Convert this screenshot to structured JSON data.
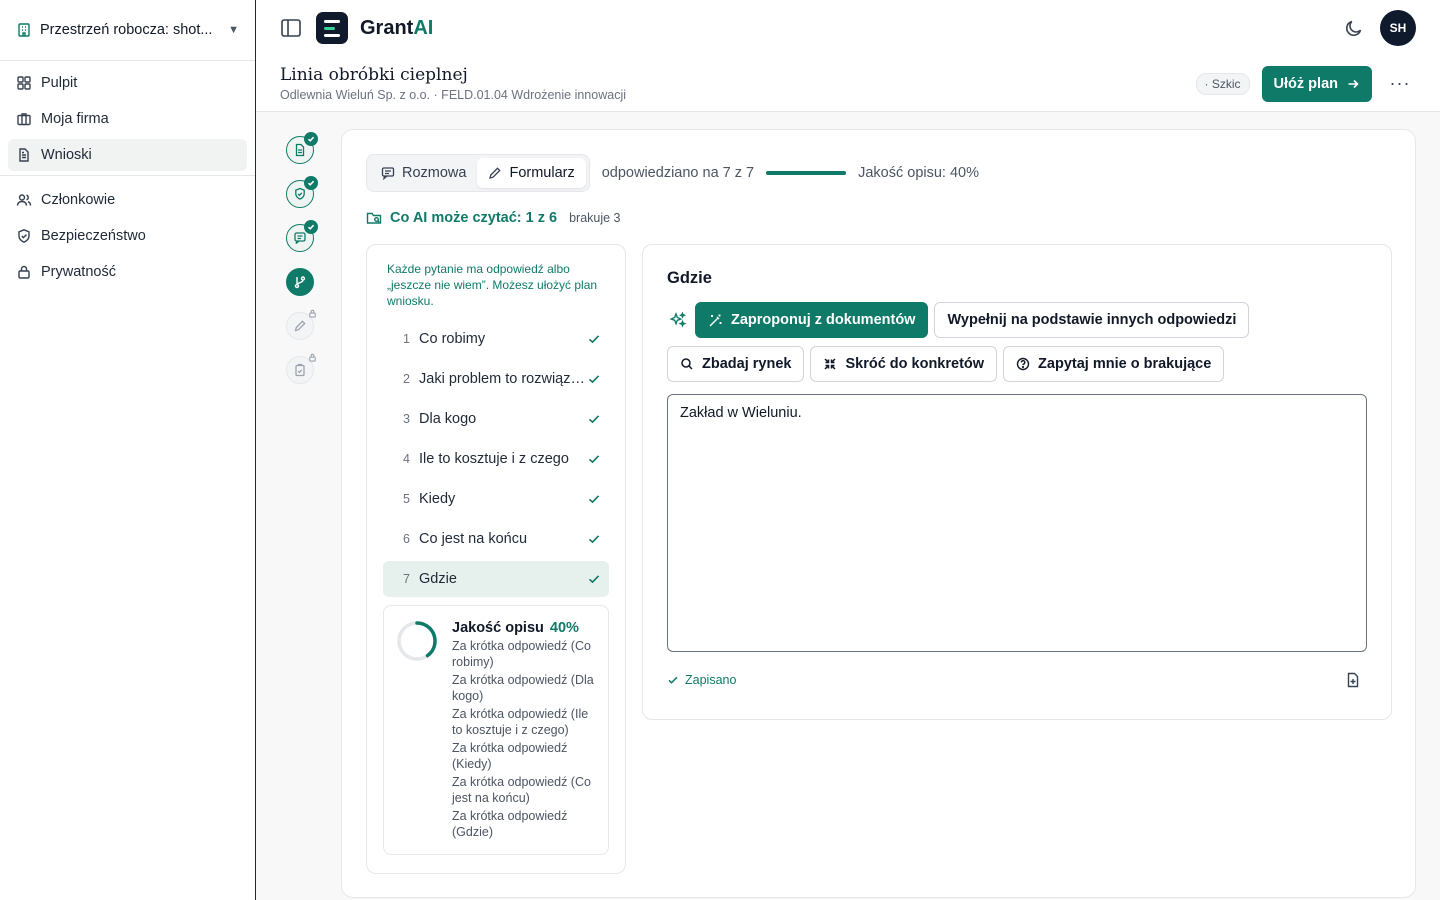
{
  "colors": {
    "brand": "#0f7a68",
    "navy": "#0f1b2d"
  },
  "sidebar": {
    "workspace": {
      "label": "Przestrzeń robocza: shot...",
      "icon": "building-icon"
    },
    "items": [
      {
        "label": "Pulpit",
        "icon": "dashboard-icon"
      },
      {
        "label": "Moja firma",
        "icon": "briefcase-icon"
      },
      {
        "label": "Wnioski",
        "icon": "document-icon",
        "active": true
      },
      {
        "label": "Członkowie",
        "icon": "users-icon"
      },
      {
        "label": "Bezpieczeństwo",
        "icon": "shield-icon"
      },
      {
        "label": "Prywatność",
        "icon": "lock-icon"
      }
    ]
  },
  "topbar": {
    "brand_main": "Grant",
    "brand_accent": "AI",
    "avatar_initials": "SH"
  },
  "header": {
    "title": "Linia obróbki cieplnej",
    "subtitle": "Odlewnia Wieluń Sp. z o.o. · FELD.01.04 Wdrożenie innowacji",
    "status_badge": "· Szkic",
    "primary_button": "Ułóż plan",
    "more": "···"
  },
  "main": {
    "tabs": [
      {
        "label": "Rozmowa",
        "icon": "chat-icon"
      },
      {
        "label": "Formularz",
        "icon": "pencil-icon",
        "active": true
      }
    ],
    "answered_text": "odpowiedziano na 7 z 7",
    "answered_fraction": 1.0,
    "quality_text": "Jakość opisu: 40%",
    "ai_read": {
      "label": "Co AI może czytać: 1 z 6",
      "missing": "brakuje 3"
    },
    "questions_hint": "Każde pytanie ma odpowiedź albo „jeszcze nie wiem”. Możesz ułożyć plan wniosku.",
    "questions": [
      {
        "num": "1",
        "label": "Co robimy"
      },
      {
        "num": "2",
        "label": "Jaki problem to rozwiązuje"
      },
      {
        "num": "3",
        "label": "Dla kogo"
      },
      {
        "num": "4",
        "label": "Ile to kosztuje i z czego"
      },
      {
        "num": "5",
        "label": "Kiedy"
      },
      {
        "num": "6",
        "label": "Co jest na końcu"
      },
      {
        "num": "7",
        "label": "Gdzie",
        "active": true
      }
    ],
    "quality": {
      "title": "Jakość opisu",
      "percent": "40%",
      "value": 0.4,
      "notes": [
        "Za krótka odpowiedź (Co robimy)",
        "Za krótka odpowiedź (Dla kogo)",
        "Za krótka odpowiedź (Ile to kosztuje i z czego)",
        "Za krótka odpowiedź (Kiedy)",
        "Za krótka odpowiedź (Co jest na końcu)",
        "Za krótka odpowiedź (Gdzie)"
      ]
    },
    "answer": {
      "title": "Gdzie",
      "actions_row1": [
        {
          "label": "Zaproponuj z dokumentów",
          "icon": "magic-wand-icon",
          "primary": true
        },
        {
          "label": "Wypełnij na podstawie innych odpowiedzi"
        }
      ],
      "actions_row2": [
        {
          "label": "Zbadaj rynek",
          "icon": "search-icon"
        },
        {
          "label": "Skróć do konkretów",
          "icon": "shrink-icon"
        },
        {
          "label": "Zapytaj mnie o brakujące",
          "icon": "help-circle-icon"
        }
      ],
      "text": "Zakład w Wieluniu.",
      "saved": "Zapisano"
    }
  }
}
